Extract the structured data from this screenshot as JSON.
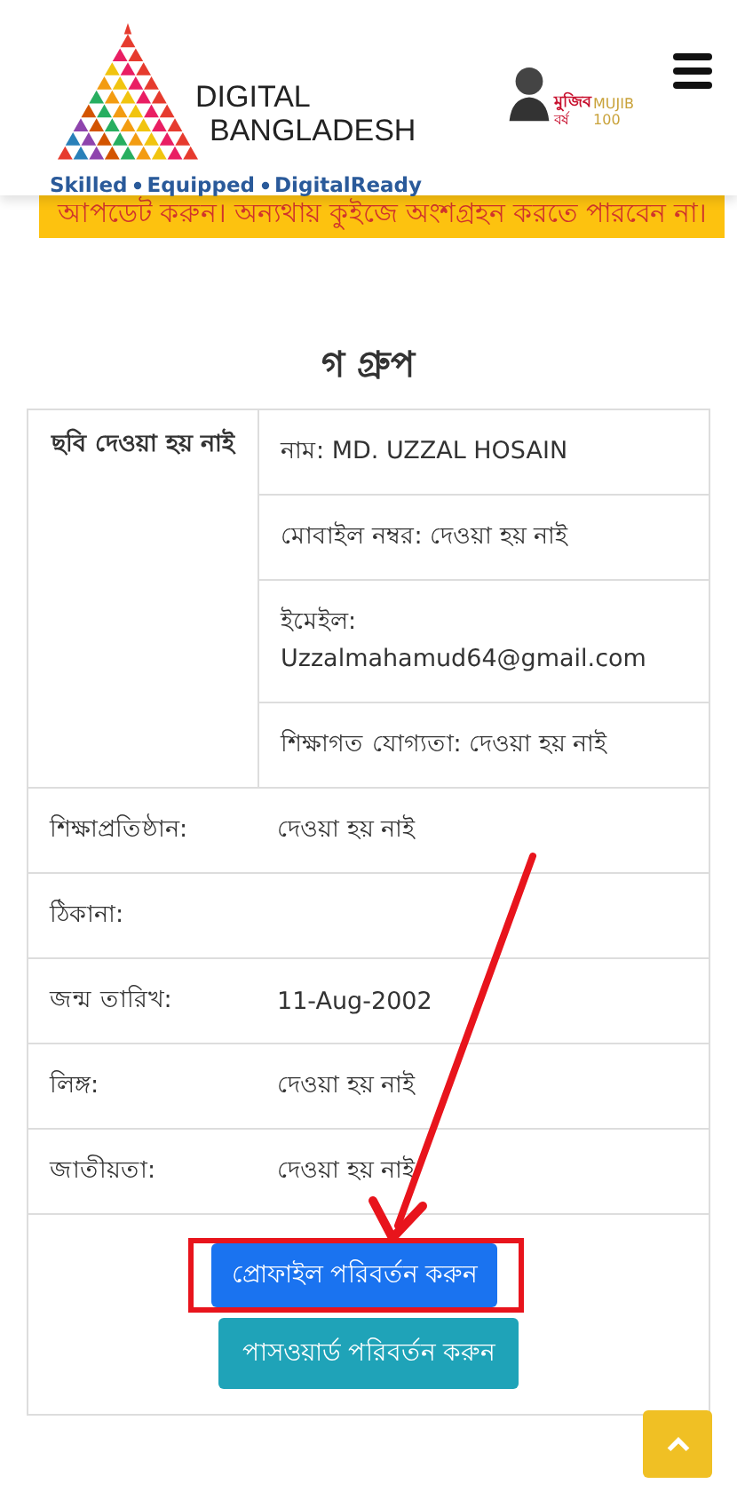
{
  "header": {
    "logo_lines": [
      "DIGITAL",
      "BANGLADESH"
    ],
    "tagline": [
      "Skilled",
      "Equipped",
      "DigitalReady"
    ],
    "badge_texts": [
      "মুজিব",
      "বর্ষ",
      "MUJIB",
      "100"
    ]
  },
  "notice": "আপডেট করুন। অন্যথায় কুইজে অংশগ্রহন করতে পারবেন না।",
  "heading": "গ গ্রুপ",
  "profile": {
    "photo_text": "ছবি দেওয়া হয় নাই",
    "summary": [
      {
        "label": "নাম:",
        "value": "MD. UZZAL HOSAIN"
      },
      {
        "label": "মোবাইল নম্বর:",
        "value": "দেওয়া হয় নাই"
      },
      {
        "label": "ইমেইল:",
        "value": "Uzzalmahamud64@gmail.com"
      },
      {
        "label": "শিক্ষাগত যোগ্যতা:",
        "value": "দেওয়া হয় নাই"
      }
    ],
    "rows": [
      {
        "label": "শিক্ষাপ্রতিষ্ঠান:",
        "value": "দেওয়া হয় নাই"
      },
      {
        "label": "ঠিকানা:"
      },
      {
        "label": "জন্ম তারিখ:",
        "value": "11-Aug-2002"
      },
      {
        "label": "লিঙ্গ:",
        "value": "দেওয়া হয় নাই"
      },
      {
        "label": "জাতীয়তা:",
        "value": "দেওয়া হয় নাই"
      }
    ]
  },
  "buttons": [
    {
      "label": "প্রোফাইল পরিবর্তন করুন",
      "kind": "primary",
      "highlighted": true
    },
    {
      "label": "পাসওয়ার্ড পরিবর্তন করুন",
      "kind": "info",
      "highlighted": false
    }
  ]
}
